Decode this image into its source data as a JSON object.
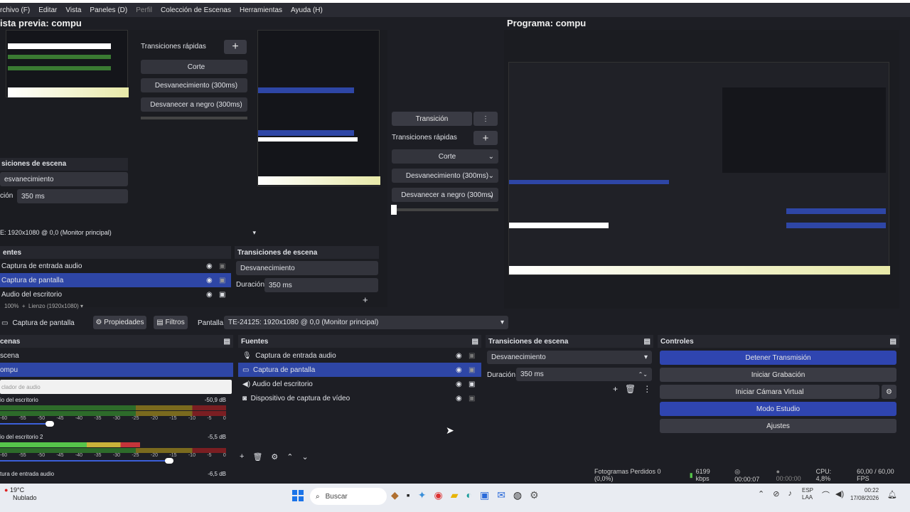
{
  "menu": [
    "rchivo (F)",
    "Editar",
    "Vista",
    "Paneles (D)",
    "Perfil",
    "Colección de Escenas",
    "Herramientas",
    "Ayuda (H)"
  ],
  "preview_title": "ista previa: compu",
  "program_title": "Programa: compu",
  "transition": {
    "label": "Transición",
    "quick_label": "Transiciones rápidas",
    "options": [
      "Corte",
      "Desvanecimiento (300ms)",
      "Desvanecer a negro (300ms)"
    ]
  },
  "nested": {
    "quick_label": "Transiciones rápidas",
    "options": [
      "Corte",
      "Desvanecimiento (300ms)",
      "Desvanecer a negro (300ms)"
    ],
    "scene_trans_header": "siciones de escena",
    "fade": "esvanecimiento",
    "duration_label": "ción",
    "duration_value": "350 ms",
    "monitor": "E: 1920x1080 @ 0,0 (Monitor principal)",
    "sources_header": "entes",
    "sources": [
      "Captura de entrada audio",
      "Captura de pantalla",
      "Audio del escritorio"
    ],
    "trans_header2": "Transiciones de escena",
    "fade2": "Desvanecimiento",
    "duration_label2": "Duración",
    "duration_value2": "350 ms",
    "zoom": "100%",
    "canvas": "Lienzo (1920x1080)"
  },
  "toolbar": {
    "source_name": "Captura de pantalla",
    "properties": "Propiedades",
    "filters": "Filtros",
    "display_label": "Pantalla",
    "display_value": "TE-24125: 1920x1080 @ 0,0 (Monitor principal)"
  },
  "scenes": {
    "header": "cenas",
    "items": [
      "scena",
      "ompu"
    ]
  },
  "mixer": {
    "header": "clador de audio",
    "channels": [
      {
        "name": "io del escritorio",
        "db": "-50,9 dB"
      },
      {
        "name": "io del escritorio 2",
        "db": "-5,5 dB"
      },
      {
        "name": "tura de entrada audio",
        "db": "-6,5 dB"
      }
    ],
    "ticks": [
      "-60",
      "-55",
      "-50",
      "-45",
      "-40",
      "-35",
      "-30",
      "-25",
      "-20",
      "-15",
      "-10",
      "-5",
      "0"
    ]
  },
  "sources": {
    "header": "Fuentes",
    "items": [
      {
        "name": "Captura de entrada audio",
        "icon": "microphone-icon"
      },
      {
        "name": "Captura de pantalla",
        "icon": "monitor-icon"
      },
      {
        "name": "Audio del escritorio",
        "icon": "speaker-icon"
      },
      {
        "name": "Dispositivo de captura de vídeo",
        "icon": "camera-icon"
      }
    ]
  },
  "scene_transitions": {
    "header": "Transiciones de escena",
    "selected": "Desvanecimiento",
    "duration_label": "Duración",
    "duration_value": "350 ms"
  },
  "controls": {
    "header": "Controles",
    "stop_stream": "Detener Transmisión",
    "start_recording": "Iniciar Grabación",
    "virtual_camera": "Iniciar Cámara Virtual",
    "studio_mode": "Modo Estudio",
    "settings": "Ajustes"
  },
  "status": {
    "dropped": "Fotogramas Perdidos 0 (0,0%)",
    "bitrate": "6199 kbps",
    "stream_time": "00:00:07",
    "rec_time": "00:00:00",
    "cpu": "CPU: 4,8%",
    "fps": "60,00 / 60,00 FPS"
  },
  "taskbar": {
    "temp": "19°C",
    "weather": "Nublado",
    "search": "Buscar",
    "lang1": "ESP",
    "lang2": "LAA",
    "time": "00:22",
    "date": "17/08/2026"
  },
  "colors": {
    "accent": "#2e46a6",
    "bg": "#1d1e24",
    "panel": "#26272e"
  }
}
